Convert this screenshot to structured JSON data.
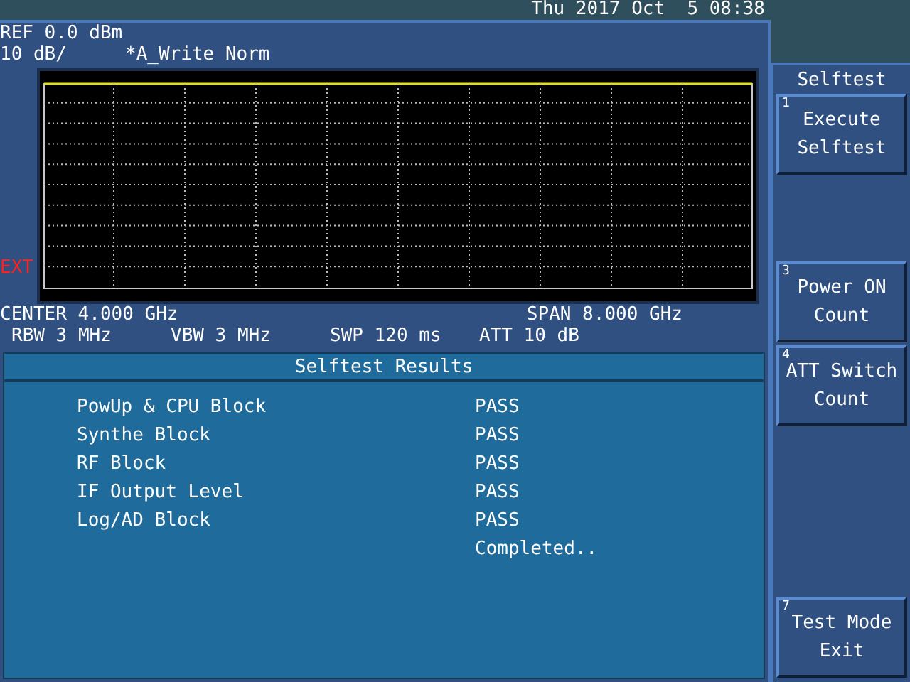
{
  "clock": "Thu 2017 Oct  5 08:38",
  "header": {
    "ref": "REF 0.0 dBm",
    "scale": "10 dB/",
    "trace": "*A_Write Norm"
  },
  "graph": {
    "ext_label": "EXT"
  },
  "settings": {
    "center": "CENTER 4.000 GHz",
    "span": "SPAN 8.000 GHz",
    "rbw": "RBW 3 MHz",
    "vbw": "VBW 3 MHz",
    "swp": "SWP 120 ms",
    "att": "ATT 10 dB"
  },
  "results": {
    "title": "Selftest Results",
    "rows": [
      {
        "item": "PowUp & CPU Block",
        "result": "PASS"
      },
      {
        "item": "Synthe Block",
        "result": "PASS"
      },
      {
        "item": "RF Block",
        "result": "PASS"
      },
      {
        "item": "IF Output Level",
        "result": "PASS"
      },
      {
        "item": "Log/AD Block",
        "result": "PASS"
      }
    ],
    "status": "Completed.."
  },
  "menu": {
    "title": "Selftest",
    "softkeys": [
      {
        "kind": "key",
        "number": "1",
        "lines": [
          "Execute",
          "Selftest"
        ]
      },
      {
        "kind": "empty"
      },
      {
        "kind": "key",
        "number": "3",
        "lines": [
          "Power ON",
          "Count"
        ]
      },
      {
        "kind": "key",
        "number": "4",
        "lines": [
          "ATT Switch",
          "Count"
        ]
      },
      {
        "kind": "empty"
      },
      {
        "kind": "empty"
      },
      {
        "kind": "key",
        "number": "7",
        "lines": [
          "Test Mode",
          "Exit"
        ]
      }
    ]
  }
}
